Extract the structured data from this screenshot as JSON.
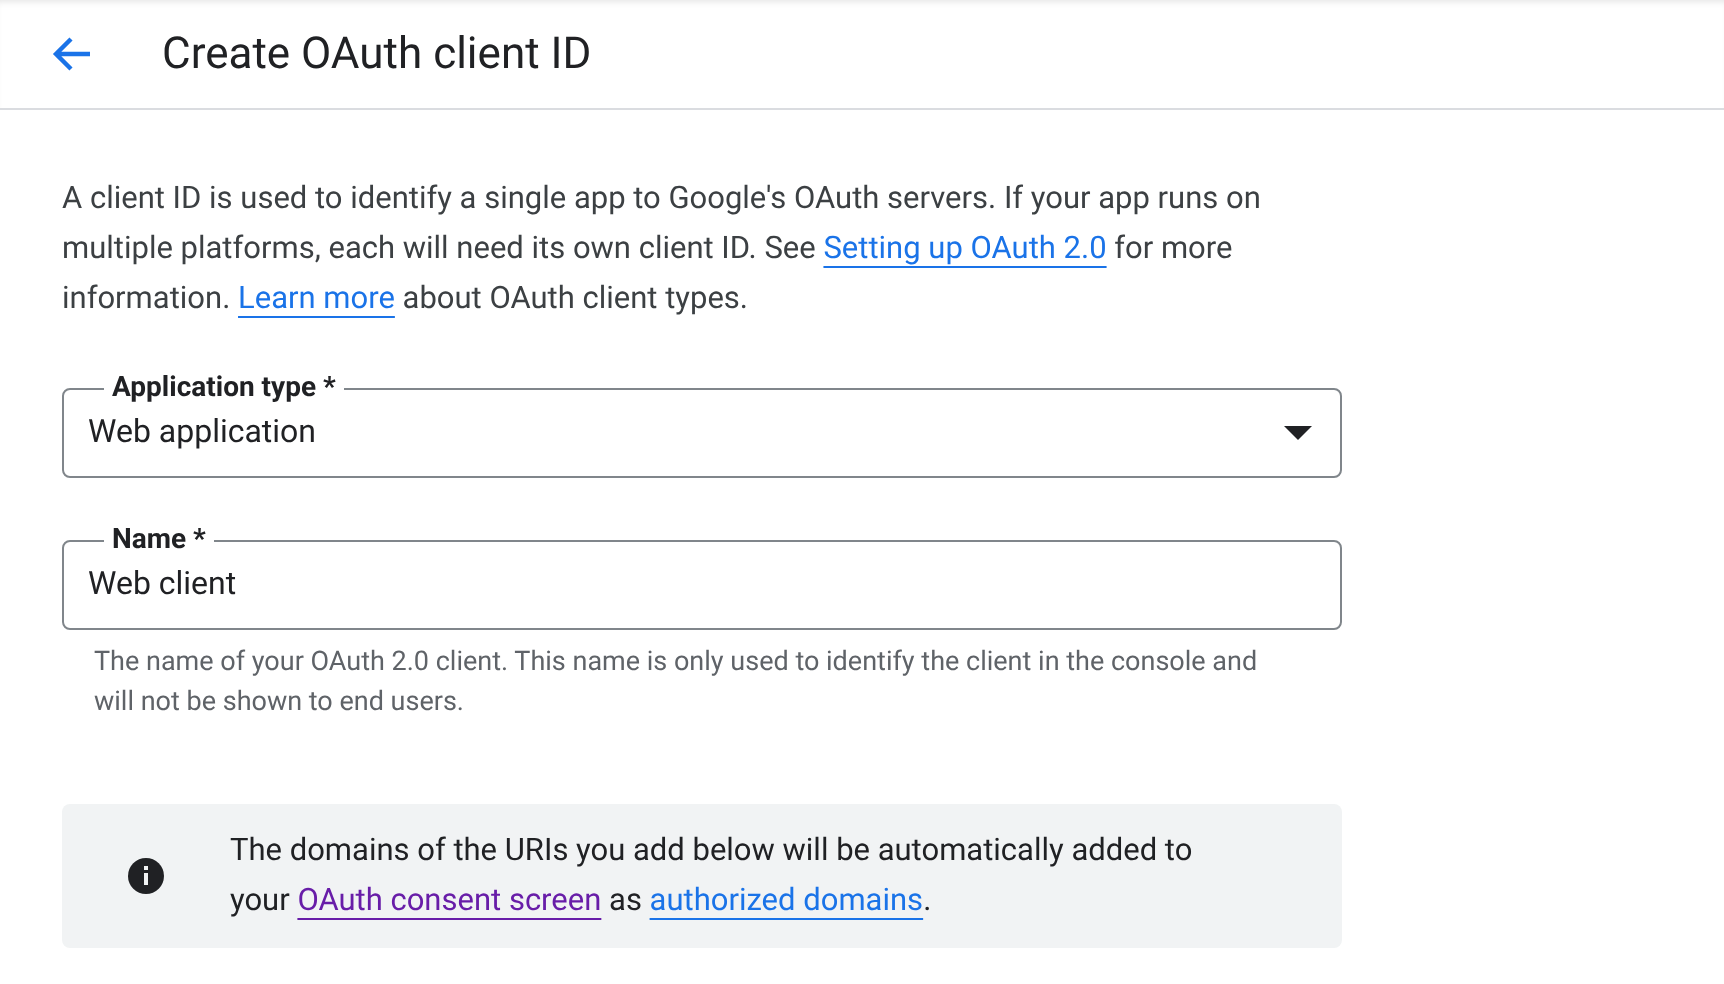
{
  "header": {
    "title": "Create OAuth client ID"
  },
  "intro": [
    {
      "kind": "text",
      "text": "A client ID is used to identify a single app to Google's OAuth servers. If your app runs on multiple platforms, each will need its own client ID. See "
    },
    {
      "kind": "link",
      "text": "Setting up OAuth 2.0",
      "visited": false
    },
    {
      "kind": "text",
      "text": " for more information. "
    },
    {
      "kind": "link",
      "text": "Learn more",
      "visited": false
    },
    {
      "kind": "text",
      "text": " about OAuth client types."
    }
  ],
  "fields": [
    {
      "kind": "select",
      "label": "Application type *",
      "value": "Web application"
    },
    {
      "kind": "input",
      "label": "Name *",
      "value": "Web client",
      "helper": "The name of your OAuth 2.0 client. This name is only used to identify the client in the console and will not be shown to end users."
    }
  ],
  "notice": [
    {
      "kind": "text",
      "text": "The domains of the URIs you add below will be automatically added to your "
    },
    {
      "kind": "link",
      "text": "OAuth consent screen",
      "visited": true
    },
    {
      "kind": "text",
      "text": " as "
    },
    {
      "kind": "link",
      "text": "authorized domains",
      "visited": false
    },
    {
      "kind": "text",
      "text": "."
    }
  ]
}
